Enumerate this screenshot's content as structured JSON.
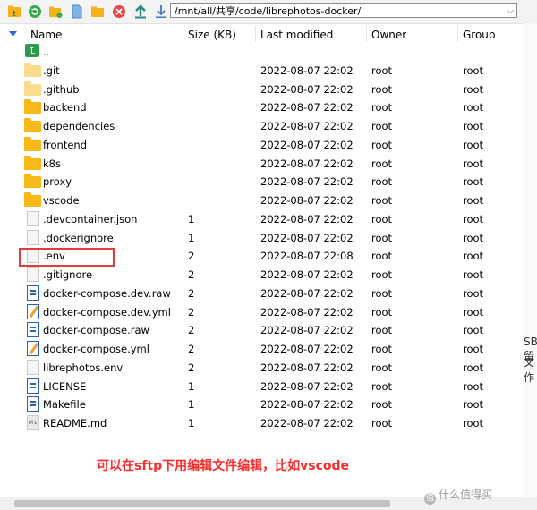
{
  "toolbar": {
    "path": "/mnt/all/共享/code/librephotos-docker/",
    "icons": [
      "parent-folder-icon",
      "refresh-icon",
      "new-folder-icon",
      "new-file-icon",
      "open-folder-icon",
      "delete-icon",
      "upload-icon",
      "download-icon"
    ]
  },
  "columns": {
    "name": "Name",
    "size": "Size (KB)",
    "modified": "Last modified",
    "owner": "Owner",
    "group": "Group"
  },
  "files": [
    {
      "name": "..",
      "size": "",
      "modified": "",
      "owner": "",
      "group": "",
      "type": "up"
    },
    {
      "name": ".git",
      "size": "",
      "modified": "2022-08-07 22:02",
      "owner": "root",
      "group": "root",
      "type": "folder-light"
    },
    {
      "name": ".github",
      "size": "",
      "modified": "2022-08-07 22:02",
      "owner": "root",
      "group": "root",
      "type": "folder-light"
    },
    {
      "name": "backend",
      "size": "",
      "modified": "2022-08-07 22:02",
      "owner": "root",
      "group": "root",
      "type": "folder"
    },
    {
      "name": "dependencies",
      "size": "",
      "modified": "2022-08-07 22:02",
      "owner": "root",
      "group": "root",
      "type": "folder"
    },
    {
      "name": "frontend",
      "size": "",
      "modified": "2022-08-07 22:02",
      "owner": "root",
      "group": "root",
      "type": "folder"
    },
    {
      "name": "k8s",
      "size": "",
      "modified": "2022-08-07 22:02",
      "owner": "root",
      "group": "root",
      "type": "folder"
    },
    {
      "name": "proxy",
      "size": "",
      "modified": "2022-08-07 22:02",
      "owner": "root",
      "group": "root",
      "type": "folder"
    },
    {
      "name": "vscode",
      "size": "",
      "modified": "2022-08-07 22:02",
      "owner": "root",
      "group": "root",
      "type": "folder"
    },
    {
      "name": ".devcontainer.json",
      "size": "1",
      "modified": "2022-08-07 22:02",
      "owner": "root",
      "group": "root",
      "type": "doc"
    },
    {
      "name": ".dockerignore",
      "size": "1",
      "modified": "2022-08-07 22:02",
      "owner": "root",
      "group": "root",
      "type": "doc"
    },
    {
      "name": ".env",
      "size": "2",
      "modified": "2022-08-07 22:08",
      "owner": "root",
      "group": "root",
      "type": "doc"
    },
    {
      "name": ".gitignore",
      "size": "2",
      "modified": "2022-08-07 22:02",
      "owner": "root",
      "group": "root",
      "type": "doc"
    },
    {
      "name": "docker-compose.dev.raw",
      "size": "2",
      "modified": "2022-08-07 22:02",
      "owner": "root",
      "group": "root",
      "type": "doc-blue"
    },
    {
      "name": "docker-compose.dev.yml",
      "size": "2",
      "modified": "2022-08-07 22:02",
      "owner": "root",
      "group": "root",
      "type": "doc-pen"
    },
    {
      "name": "docker-compose.raw",
      "size": "2",
      "modified": "2022-08-07 22:02",
      "owner": "root",
      "group": "root",
      "type": "doc-blue"
    },
    {
      "name": "docker-compose.yml",
      "size": "2",
      "modified": "2022-08-07 22:02",
      "owner": "root",
      "group": "root",
      "type": "doc-pen"
    },
    {
      "name": "librephotos.env",
      "size": "2",
      "modified": "2022-08-07 22:02",
      "owner": "root",
      "group": "root",
      "type": "doc"
    },
    {
      "name": "LICENSE",
      "size": "1",
      "modified": "2022-08-07 22:02",
      "owner": "root",
      "group": "root",
      "type": "doc-blue"
    },
    {
      "name": "Makefile",
      "size": "1",
      "modified": "2022-08-07 22:02",
      "owner": "root",
      "group": "root",
      "type": "doc-blue"
    },
    {
      "name": "README.md",
      "size": "1",
      "modified": "2022-08-07 22:02",
      "owner": "root",
      "group": "root",
      "type": "doc-md"
    }
  ],
  "annotation": "可以在sftp下用编辑文件编辑，比如vscode",
  "side_text": [
    "SB留",
    "文作"
  ],
  "watermark": "什么值得买",
  "watermark_glyph": "值",
  "md_badge": "M↓",
  "up_glyph": "⮤",
  "colors": {
    "folder": "#f7b818",
    "folder_light": "#f9dc8c",
    "highlight": "#e03c3c",
    "annotation": "#ff2b2b",
    "up_arrow": "#2e9a4a",
    "doc_blue": "#2a62b8",
    "sort_arrow": "#2b6cd1"
  }
}
